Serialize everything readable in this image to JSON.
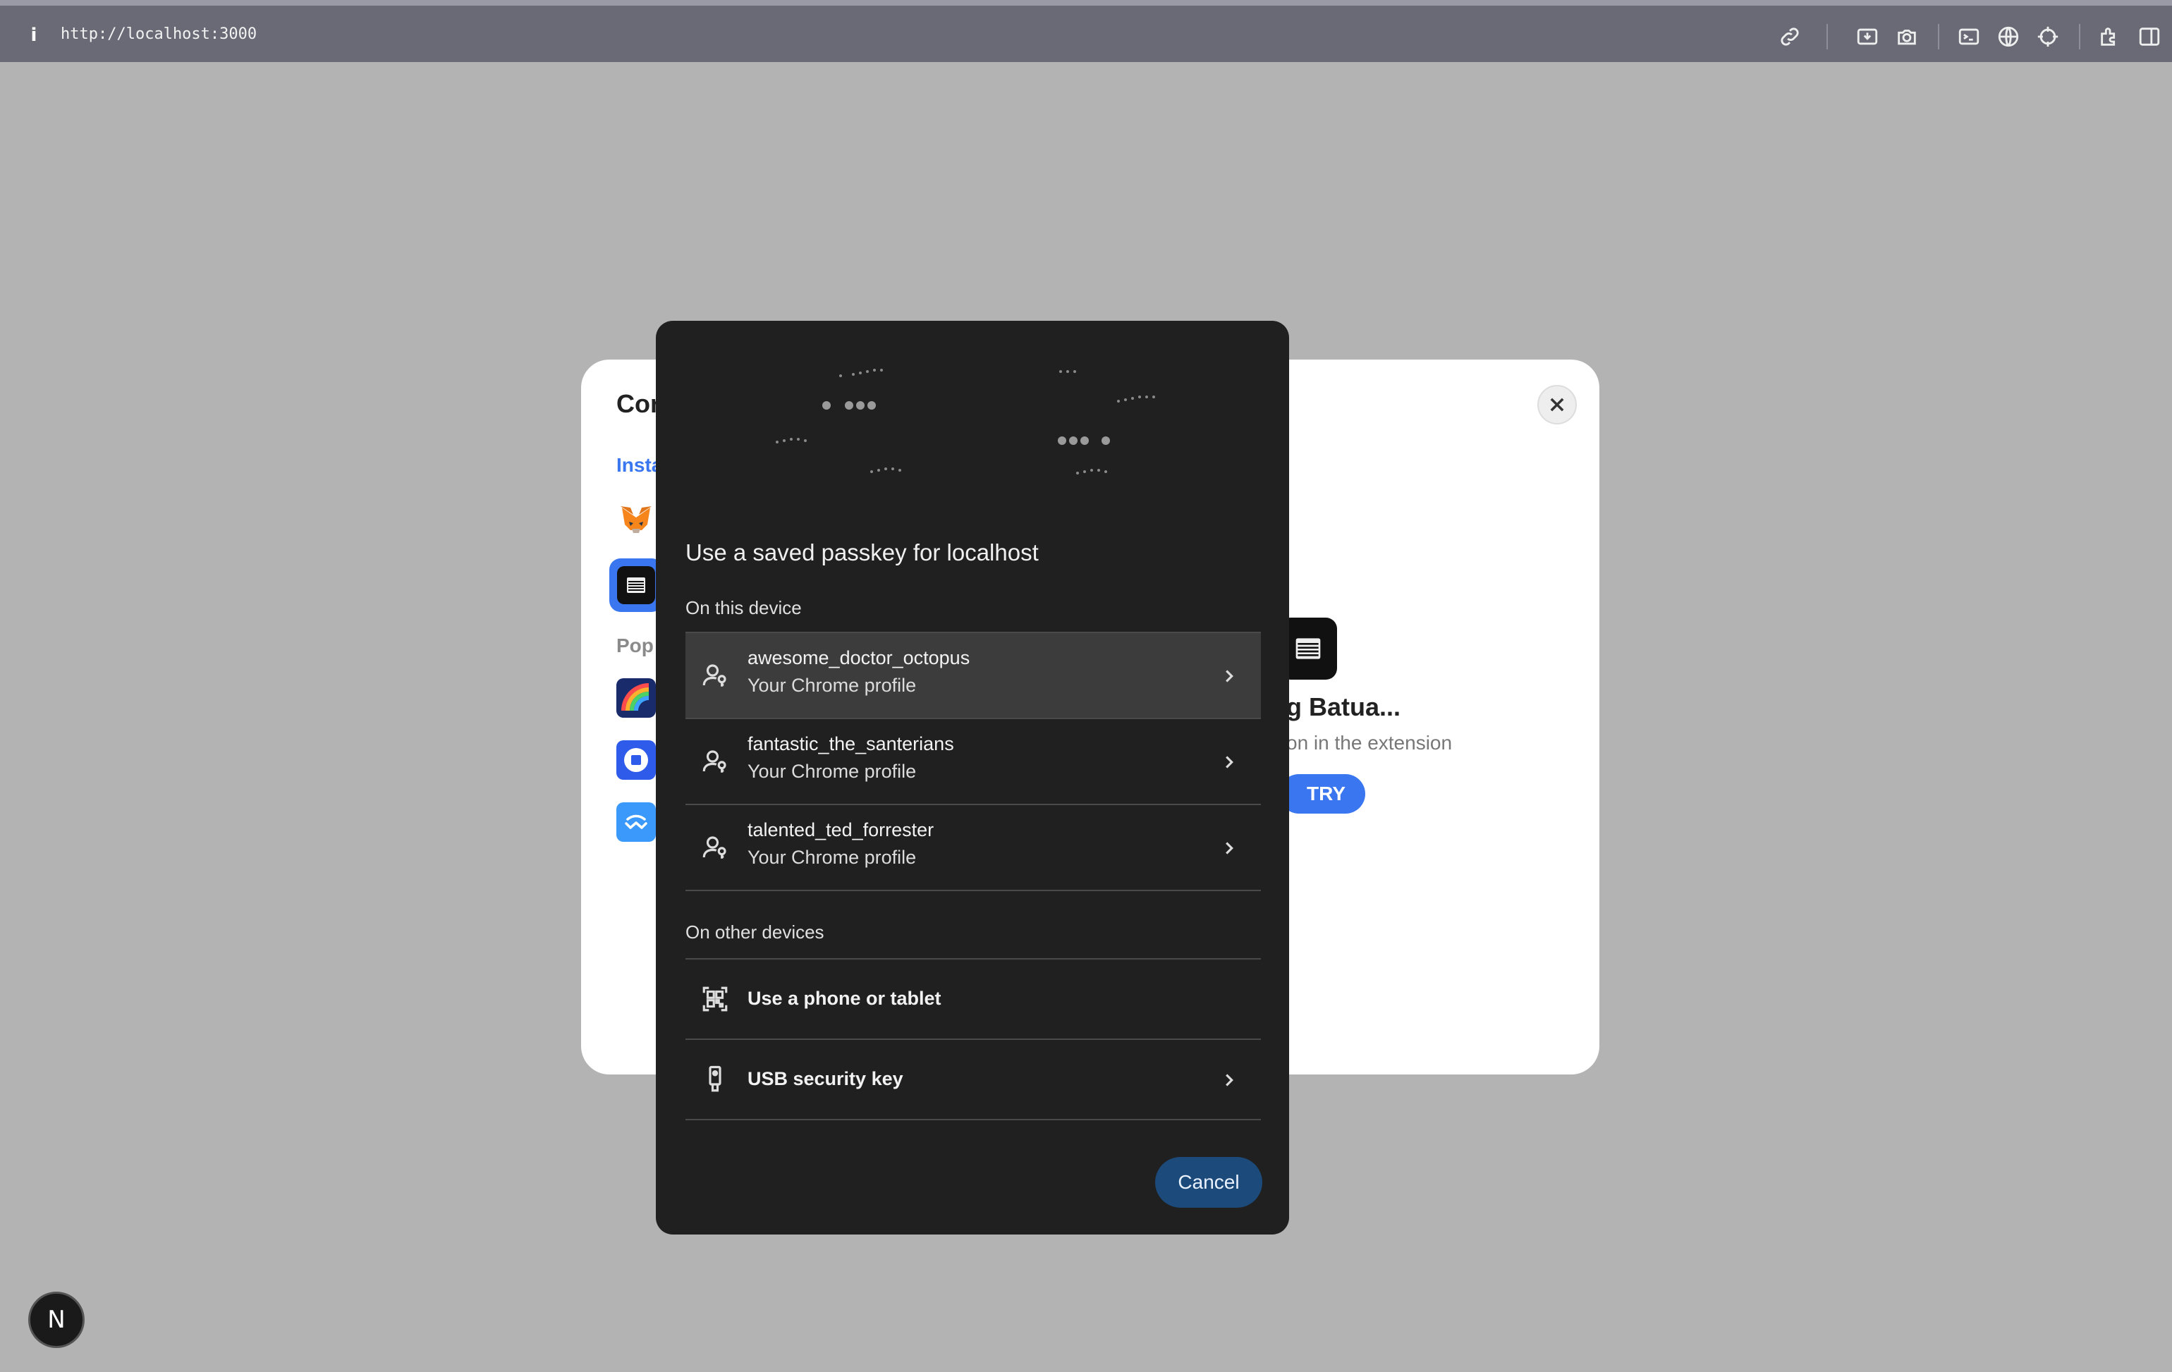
{
  "browser": {
    "url": "http://localhost:3000",
    "info_icon": "i",
    "toolbar_icons": [
      "link-icon",
      "screenshot-icon",
      "camera-icon",
      "terminal-icon",
      "globe-icon",
      "crosshair-icon",
      "extension-icon",
      "sidebar-icon"
    ]
  },
  "background_modal": {
    "title": "Cor",
    "installed_label": "Insta",
    "popular_label": "Pop",
    "connecting_name": "g Batua...",
    "connecting_sub": "on in the extension",
    "retry_label": "TRY"
  },
  "passkey_dialog": {
    "title": "Use a saved passkey for localhost",
    "on_this_device": "On this device",
    "passkeys": [
      {
        "name": "awesome_doctor_octopus",
        "source": "Your Chrome profile"
      },
      {
        "name": "fantastic_the_santerians",
        "source": "Your Chrome profile"
      },
      {
        "name": "talented_ted_forrester",
        "source": "Your Chrome profile"
      }
    ],
    "on_other_devices": "On other devices",
    "phone_option": "Use a phone or tablet",
    "usb_option": "USB security key",
    "cancel_label": "Cancel"
  },
  "floating_button": {
    "label": "N"
  },
  "colors": {
    "dialog_bg": "#202020",
    "accent": "#3a76f0",
    "cancel_bg": "#1c4a7a",
    "page_bg": "#b3b3b3"
  }
}
